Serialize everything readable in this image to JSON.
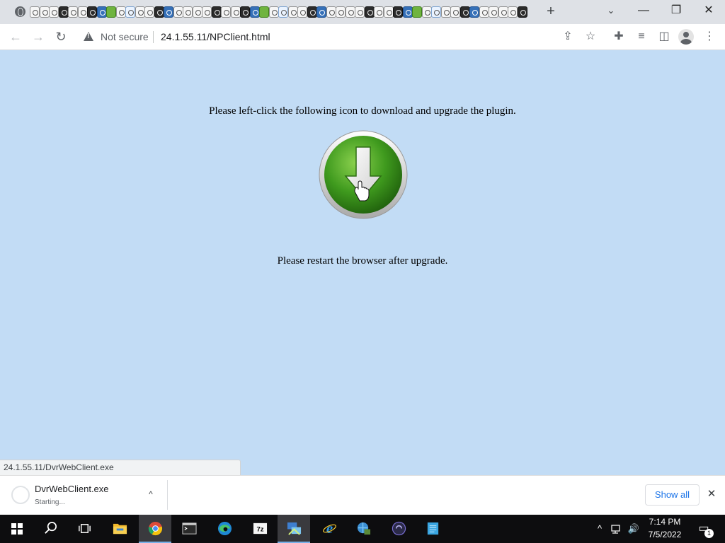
{
  "browser": {
    "tabstrip": {
      "favicon_count": 52,
      "new_tab_glyph": "+",
      "tab_search_glyph": "⌄",
      "minimize_glyph": "—",
      "restore_glyph": "❐",
      "close_glyph": "✕"
    },
    "toolbar": {
      "back_glyph": "←",
      "forward_glyph": "→",
      "reload_glyph": "↻",
      "security_label": "Not secure",
      "url": "24.1.55.11/NPClient.html",
      "share_glyph": "⇪",
      "bookmark_glyph": "☆",
      "extensions_glyph": "✚",
      "media_glyph": "≡",
      "sidepanel_glyph": "◫",
      "menu_glyph": "⋮"
    }
  },
  "page": {
    "instruction_text": "Please left-click the following icon to download and upgrade the plugin.",
    "restart_text": "Please restart the browser after upgrade.",
    "status_url": "24.1.55.11/DvrWebClient.exe"
  },
  "download_shelf": {
    "file_name": "DvrWebClient.exe",
    "status": "Starting...",
    "chevron_glyph": "^",
    "show_all_label": "Show all",
    "close_glyph": "✕"
  },
  "taskbar": {
    "apps": [
      "start-icon",
      "search-icon",
      "task-view-icon",
      "file-explorer-icon",
      "chrome-icon",
      "terminal-icon",
      "edge-icon",
      "7zip-icon",
      "network-tool-icon",
      "internet-explorer-icon",
      "settings-app-icon",
      "obs-icon",
      "notepad-icon"
    ],
    "tray": {
      "time": "7:14 PM",
      "date": "7/5/2022",
      "chevron_glyph": "^",
      "volume_glyph": "🔊",
      "notification_glyph": "▭",
      "notification_count": "1"
    }
  },
  "colors": {
    "page_background": "#c2dcf5",
    "download_green": "#3f9a1e",
    "link_blue": "#1a73e8",
    "taskbar": "#0d0d0f"
  }
}
